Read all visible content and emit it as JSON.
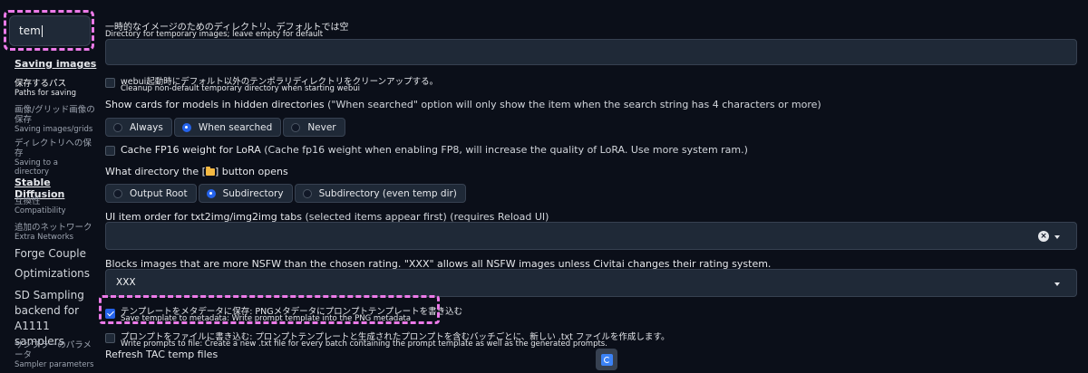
{
  "sidebar": {
    "search_value": "tem",
    "items": [
      {
        "head": "Saving images"
      },
      {
        "jp": "保存するパス",
        "en": "Paths for saving"
      },
      {
        "jp": "画像/グリッド画像の保存",
        "en": "Saving images/grids"
      },
      {
        "jp": "ディレクトリへの保存",
        "en": "Saving to a directory"
      },
      {
        "head": "Stable Diffusion"
      },
      {
        "jp": "互換性",
        "en": "Compatibility"
      },
      {
        "jp": "追加のネットワーク",
        "en": "Extra Networks"
      },
      {
        "big": "Forge Couple"
      },
      {
        "big": "Optimizations"
      },
      {
        "big": "SD Sampling backend for A1111 samplers"
      },
      {
        "jp": "サンプラーのパラメータ",
        "en": "Sampler parameters"
      }
    ]
  },
  "settings": {
    "temp_dir": {
      "label_jp": "一時的なイメージのためのディレクトリ、デフォルトでは空",
      "label_en": "Directory for temporary images; leave empty for default",
      "value": ""
    },
    "cleanup": {
      "label_jp": "webui起動時にデフォルト以外のテンポラリディレクトリをクリーンアップする。",
      "label_en": "Cleanup non-default temporary directory when starting webui",
      "checked": false
    },
    "hidden_dirs": {
      "label": "Show cards for models in hidden directories",
      "note": "(\"When searched\" option will only show the item when the search string has 4 characters or more)",
      "options": [
        "Always",
        "When searched",
        "Never"
      ],
      "selected": "When searched"
    },
    "fp16_lora": {
      "label": "Cache FP16 weight for LoRA",
      "note": "(Cache fp16 weight when enabling FP8, will increase the quality of LoRA. Use more system ram.)",
      "checked": false
    },
    "folder_button": {
      "label_pre": "What directory the [",
      "label_post": "] button opens",
      "options": [
        "Output Root",
        "Subdirectory",
        "Subdirectory (even temp dir)"
      ],
      "selected": "Subdirectory"
    },
    "ui_order": {
      "label": "UI item order for txt2img/img2img tabs",
      "note": "(selected items appear first) (requires Reload UI)",
      "clear_symbol": "×"
    },
    "nsfw": {
      "label": "Blocks images that are more NSFW than the chosen rating. \"XXX\" allows all NSFW images unless Civitai changes their rating system.",
      "value": "XXX"
    },
    "save_template": {
      "label_jp": "テンプレートをメタデータに保存: PNGメタデータにプロンプトテンプレートを書き込む",
      "label_en": "Save template to metadata: Write prompt template into the PNG metadata",
      "checked": true
    },
    "write_prompts": {
      "label_jp": "プロンプトをファイルに書き込む: プロンプトテンプレートと生成されたプロンプトを含むバッチごとに、新しい .txt ファイルを作成します。",
      "label_en": "Write prompts to file: Create a new .txt file for every batch containing the prompt template as well as the generated prompts.",
      "checked": false
    },
    "refresh_tac": {
      "label": "Refresh TAC temp files"
    }
  },
  "colors": {
    "background": "#0b0f19",
    "accent": "#2563eb",
    "highlight": "#ec7ae8"
  }
}
